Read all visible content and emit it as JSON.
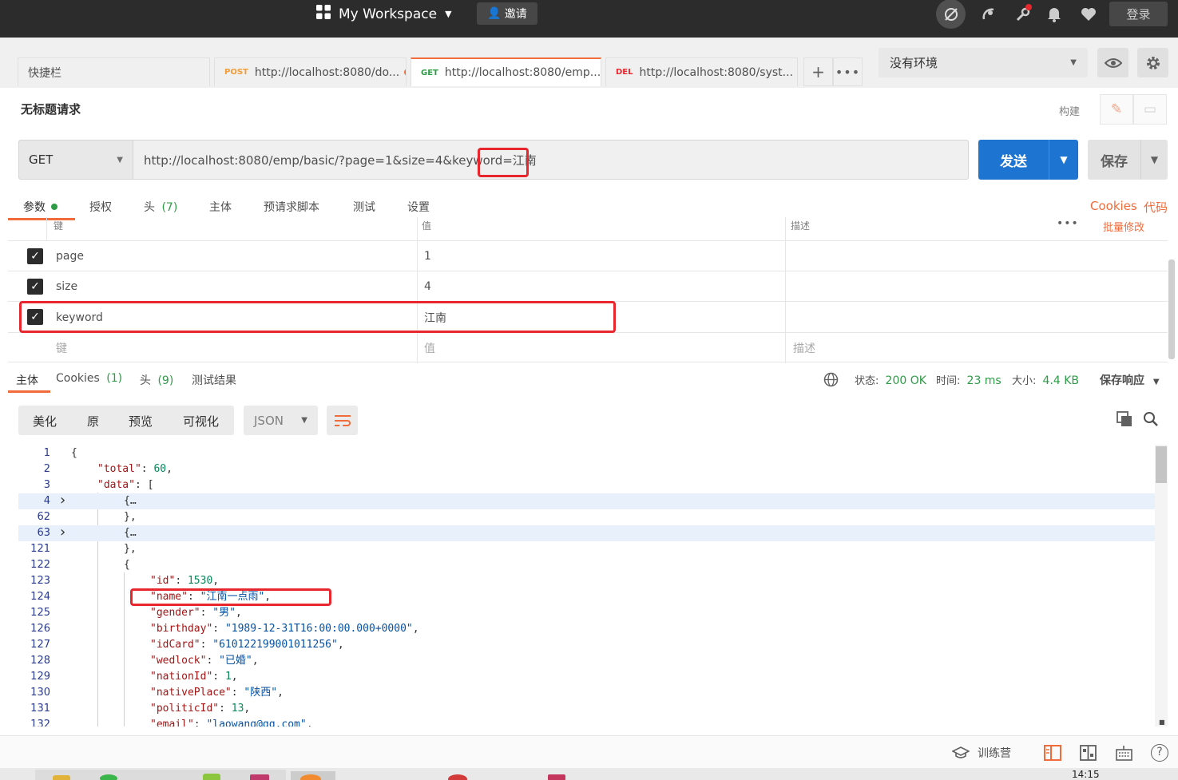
{
  "topbar": {
    "workspace_label": "My Workspace",
    "invite_label": "邀请",
    "login_label": "登录",
    "icons": [
      "grid-icon",
      "sync-off-icon",
      "satellite-icon",
      "wrench-icon",
      "bell-icon",
      "heart-icon"
    ]
  },
  "tabs": [
    {
      "label": "快捷栏"
    },
    {
      "method": "POST",
      "label": "http://localhost:8080/do...",
      "method_color": "#f29c38"
    },
    {
      "method": "GET",
      "label": "http://localhost:8080/emp...",
      "method_color": "#2e9b47"
    },
    {
      "method": "DEL",
      "label": "http://localhost:8080/syst...",
      "method_color": "#e8262e"
    }
  ],
  "environment": {
    "selected": "没有环境"
  },
  "request": {
    "title": "无标题请求",
    "build_label": "构建",
    "method": "GET",
    "url": "http://localhost:8080/emp/basic/?page=1&size=4&keyword=江南",
    "send_label": "发送",
    "save_label": "保存"
  },
  "request_tabs": {
    "params": "参数",
    "auth": "授权",
    "headers": "头",
    "headers_count": "(7)",
    "body": "主体",
    "prerequest": "预请求脚本",
    "tests": "测试",
    "settings": "设置",
    "cookies": "Cookies",
    "code": "代码"
  },
  "params_table": {
    "header_key": "键",
    "header_value": "值",
    "header_desc": "描述",
    "bulk_edit": "批量修改",
    "rows": [
      {
        "key": "page",
        "value": "1"
      },
      {
        "key": "size",
        "value": "4"
      },
      {
        "key": "keyword",
        "value": "江南"
      }
    ],
    "placeholder_key": "键",
    "placeholder_value": "值",
    "placeholder_desc": "描述"
  },
  "response_tabs": {
    "body": "主体",
    "cookies": "Cookies",
    "cookies_count": "(1)",
    "headers": "头",
    "headers_count": "(9)",
    "test_results": "测试结果"
  },
  "response_status": {
    "status_label": "状态:",
    "status_value": "200 OK",
    "time_label": "时间:",
    "time_value": "23 ms",
    "size_label": "大小:",
    "size_value": "4.4 KB",
    "save_response": "保存响应"
  },
  "format_bar": {
    "pretty": "美化",
    "raw": "原",
    "preview": "预览",
    "visualize": "可视化",
    "language": "JSON"
  },
  "code_lines": [
    {
      "n": "1",
      "text": "{"
    },
    {
      "n": "2",
      "key": "\"total\"",
      "value": "60",
      "vtype": "n"
    },
    {
      "n": "3",
      "key": "\"data\"",
      "value": "[",
      "vtype": "p"
    },
    {
      "n": "4",
      "text": "{…",
      "folded": true
    },
    {
      "n": "62",
      "text": "},"
    },
    {
      "n": "63",
      "text": "{…",
      "folded": true
    },
    {
      "n": "121",
      "text": "},"
    },
    {
      "n": "122",
      "text": "{"
    },
    {
      "n": "123",
      "key": "\"id\"",
      "value": "1530",
      "vtype": "n"
    },
    {
      "n": "124",
      "key": "\"name\"",
      "value": "\"江南一点雨\"",
      "vtype": "s"
    },
    {
      "n": "125",
      "key": "\"gender\"",
      "value": "\"男\"",
      "vtype": "s"
    },
    {
      "n": "126",
      "key": "\"birthday\"",
      "value": "\"1989-12-31T16:00:00.000+0000\"",
      "vtype": "s"
    },
    {
      "n": "127",
      "key": "\"idCard\"",
      "value": "\"610122199001011256\"",
      "vtype": "s"
    },
    {
      "n": "128",
      "key": "\"wedlock\"",
      "value": "\"已婚\"",
      "vtype": "s"
    },
    {
      "n": "129",
      "key": "\"nationId\"",
      "value": "1",
      "vtype": "n"
    },
    {
      "n": "130",
      "key": "\"nativePlace\"",
      "value": "\"陕西\"",
      "vtype": "s"
    },
    {
      "n": "131",
      "key": "\"politicId\"",
      "value": "13",
      "vtype": "n"
    },
    {
      "n": "132",
      "key": "\"email\"",
      "value": "\"laowang@qq.com\"",
      "vtype": "s"
    }
  ],
  "statusbar": {
    "bootcamp_label": "训练营"
  },
  "taskbar": {
    "clock": "14:15"
  },
  "colors": {
    "accent": "#f26b3a",
    "send_blue": "#1e75d1",
    "highlight_red": "#e8262e",
    "ok_green": "#2e9b47"
  }
}
